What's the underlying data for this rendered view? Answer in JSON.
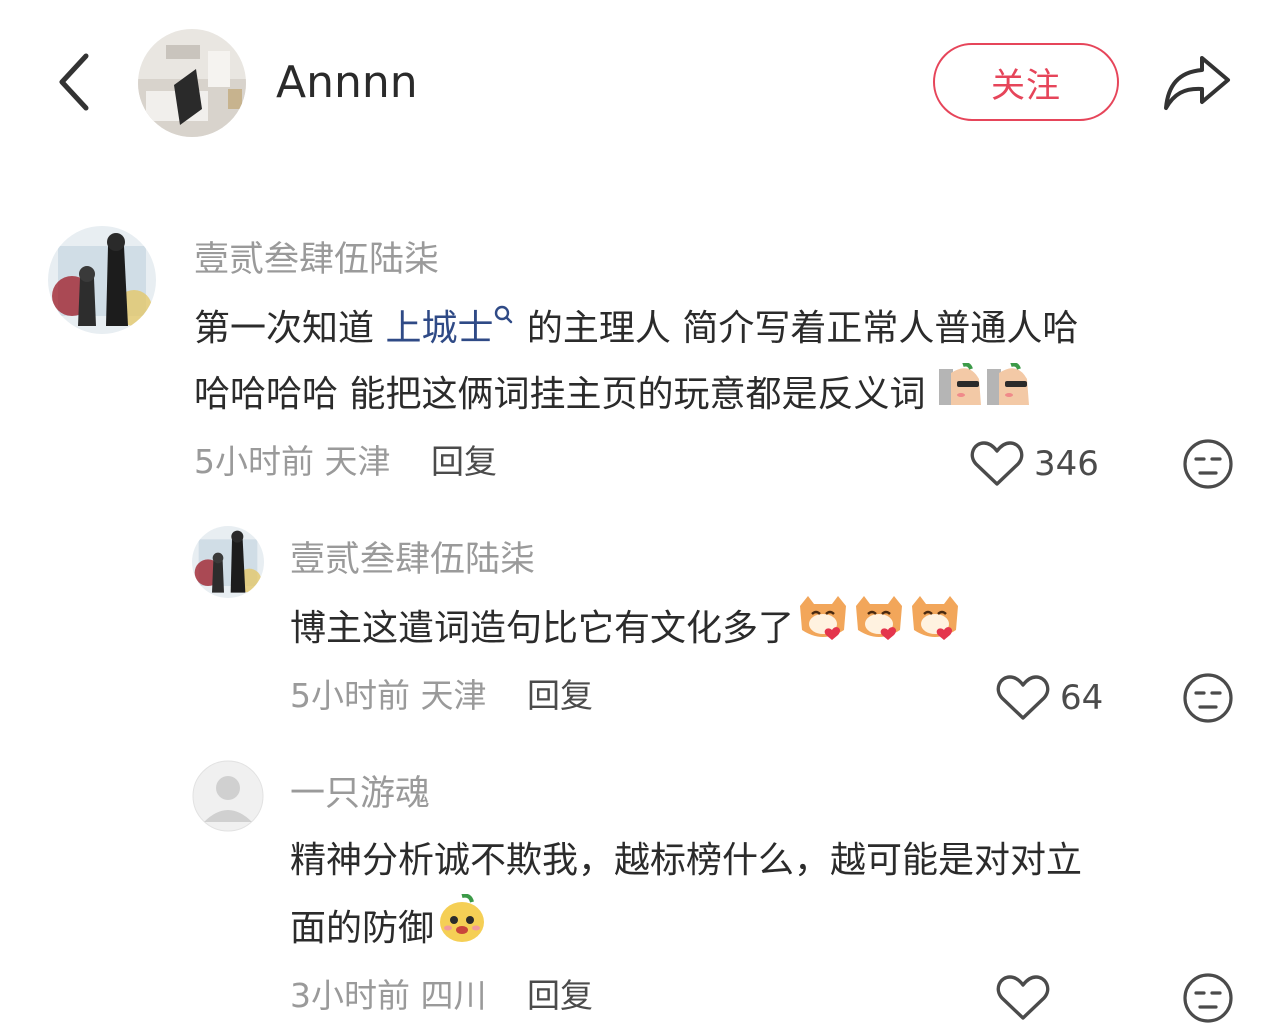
{
  "header": {
    "author_name": "Annnn",
    "follow_label": "关注"
  },
  "comments": [
    {
      "nickname": "壹贰叁肆伍陆柒",
      "text_before": "第一次知道 ",
      "topic": "上城士",
      "text_after": " 的主理人 简介写着正常人普通人哈",
      "text_line2": "哈哈哈哈 能把这俩词挂主页的玩意都是反义词",
      "time": "5小时前",
      "location": "天津",
      "reply_label": "回复",
      "likes": "346"
    },
    {
      "nickname": "壹贰叁肆伍陆柒",
      "text": "博主这遣词造句比它有文化多了",
      "time": "5小时前",
      "location": "天津",
      "reply_label": "回复",
      "likes": "64"
    },
    {
      "nickname": "一只游魂",
      "text_line1": "精神分析诚不欺我，越标榜什么，越可能是对对立",
      "text_line2": "面的防御",
      "time": "3小时前",
      "location": "四川",
      "reply_label": "回复",
      "likes": ""
    }
  ],
  "colors": {
    "accent_red": "#e6455a",
    "topic_blue": "#2f4a86",
    "meta_gray": "#9a9a9a"
  }
}
